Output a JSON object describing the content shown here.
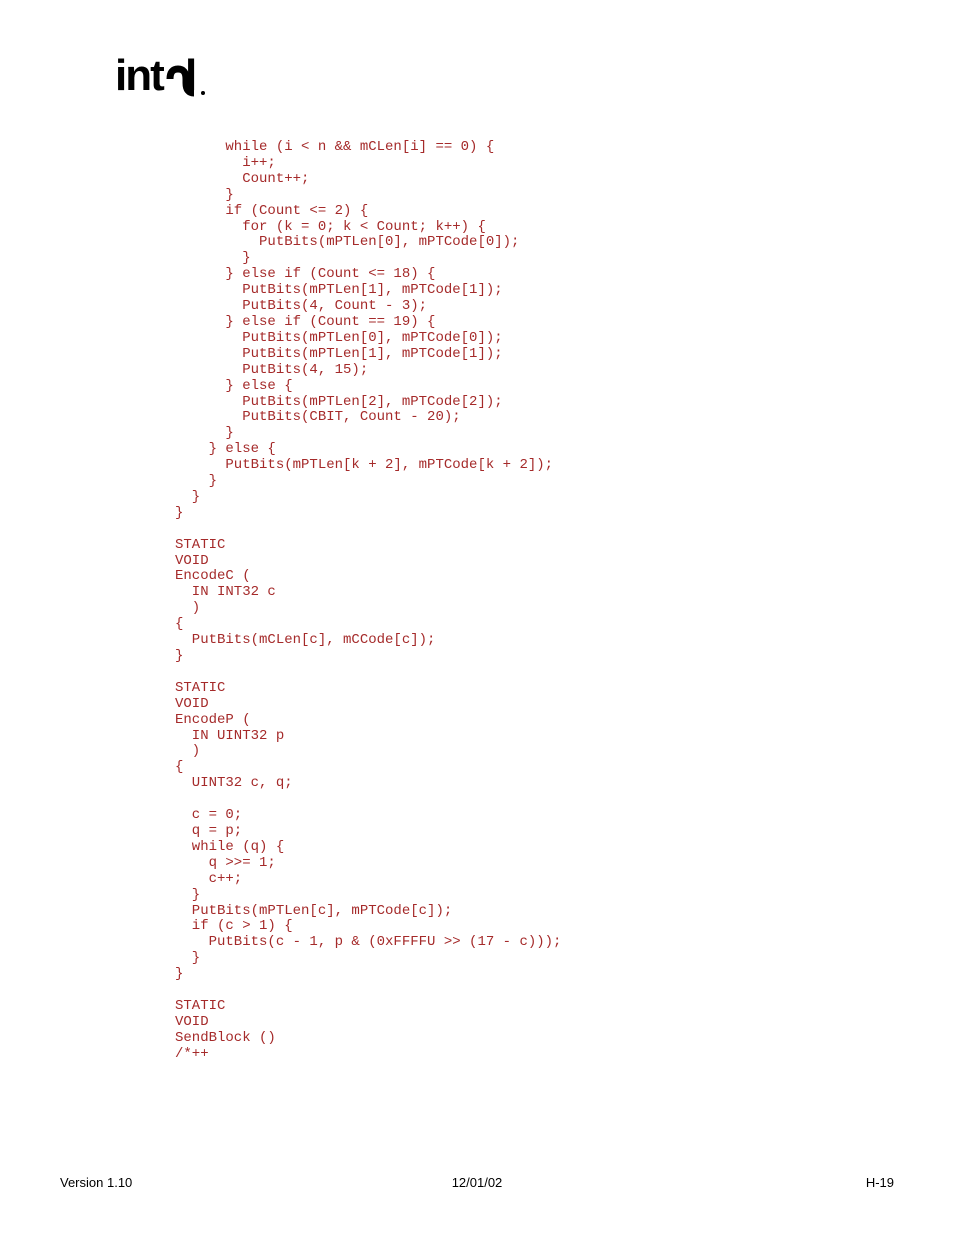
{
  "logo_alt": "intel",
  "code": "      while (i < n && mCLen[i] == 0) {\n        i++;\n        Count++;\n      }\n      if (Count <= 2) {\n        for (k = 0; k < Count; k++) {\n          PutBits(mPTLen[0], mPTCode[0]);\n        }\n      } else if (Count <= 18) {\n        PutBits(mPTLen[1], mPTCode[1]);\n        PutBits(4, Count - 3);\n      } else if (Count == 19) {\n        PutBits(mPTLen[0], mPTCode[0]);\n        PutBits(mPTLen[1], mPTCode[1]);\n        PutBits(4, 15);\n      } else {\n        PutBits(mPTLen[2], mPTCode[2]);\n        PutBits(CBIT, Count - 20);\n      }\n    } else {\n      PutBits(mPTLen[k + 2], mPTCode[k + 2]);\n    }\n  }\n}\n\nSTATIC\nVOID\nEncodeC (\n  IN INT32 c\n  )\n{\n  PutBits(mCLen[c], mCCode[c]);\n}\n\nSTATIC\nVOID\nEncodeP (\n  IN UINT32 p\n  )\n{\n  UINT32 c, q;\n\n  c = 0;\n  q = p;\n  while (q) {\n    q >>= 1;\n    c++;\n  }\n  PutBits(mPTLen[c], mPTCode[c]);\n  if (c > 1) {\n    PutBits(c - 1, p & (0xFFFFU >> (17 - c)));\n  }\n}\n\nSTATIC\nVOID\nSendBlock ()\n/*++",
  "footer": {
    "version": "Version 1.10",
    "date": "12/01/02",
    "page": "H-19"
  }
}
